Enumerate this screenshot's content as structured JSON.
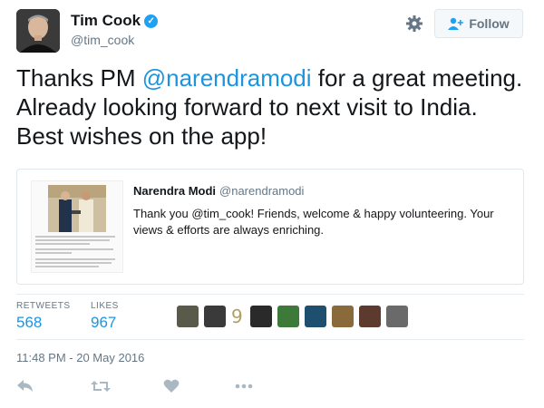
{
  "author": {
    "name": "Tim Cook",
    "handle": "@tim_cook",
    "verified": true
  },
  "follow_button": {
    "label": "Follow",
    "icon": "person-add-icon"
  },
  "settings_icon": "gear-icon",
  "tweet": {
    "parts": [
      {
        "text": "Thanks PM ",
        "type": "text"
      },
      {
        "text": "@narendramodi",
        "type": "mention"
      },
      {
        "text": " for a great meeting. Already looking forward to next visit to India. Best wishes on the app!",
        "type": "text"
      }
    ]
  },
  "quoted_tweet": {
    "name": "Narendra Modi",
    "handle": "@narendramodi",
    "text": "Thank you @tim_cook! Friends, welcome & happy volunteering. Your views & efforts are always enriching."
  },
  "stats": {
    "retweets": {
      "label": "RETWEETS",
      "value": "568"
    },
    "likes": {
      "label": "LIKES",
      "value": "967"
    }
  },
  "likers": {
    "count_glyph": "9"
  },
  "timestamp": "11:48 PM - 20 May 2016",
  "actions": [
    "reply-icon",
    "retweet-icon",
    "like-icon",
    "more-icon"
  ],
  "colors": {
    "link": "#1b95e0",
    "verified": "#1da1f2",
    "secondary_text": "#657786",
    "divider": "#e6ecf0"
  }
}
